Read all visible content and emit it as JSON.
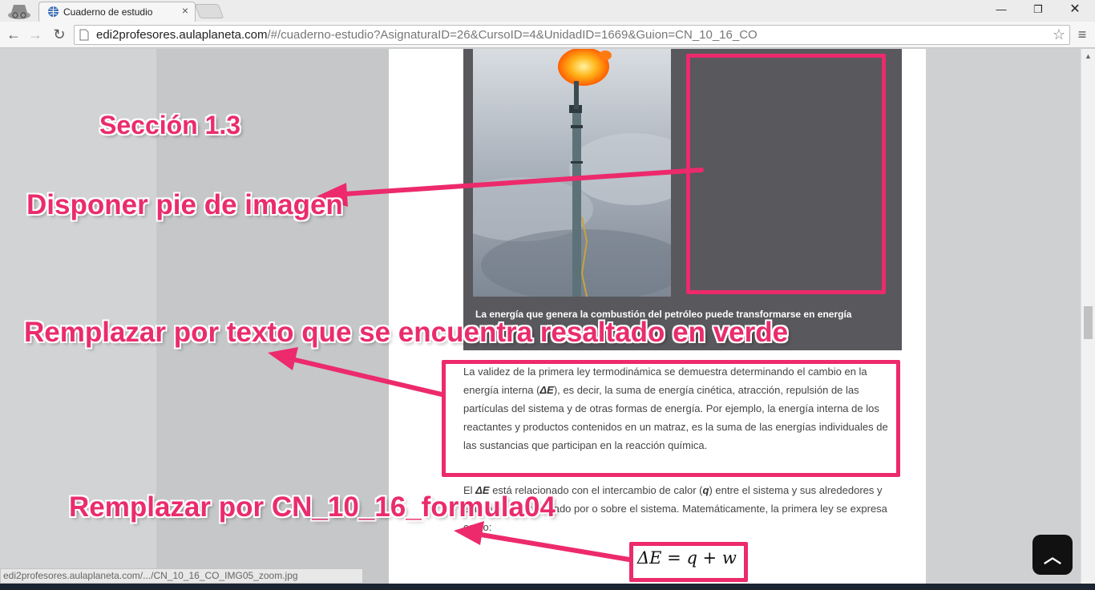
{
  "browser": {
    "tab_title": "Cuaderno de estudio",
    "tab_close": "×",
    "url_host": "edi2profesores.aulaplaneta.com",
    "url_path": "/#/cuaderno-estudio?AsignaturaID=26&CursoID=4&UnidadID=1669&Guion=CN_10_16_CO",
    "window_controls": {
      "minimize": "—",
      "maximize": "❐",
      "close": "✕"
    },
    "nav": {
      "back": "←",
      "forward": "→",
      "reload": "↻",
      "star": "☆",
      "menu": "≡"
    },
    "icons": [
      "incognito-icon",
      "globe-icon",
      "page-icon",
      "star-icon",
      "menu-icon"
    ]
  },
  "page": {
    "figure_caption": "La energía que genera la combustión del petróleo puede transformarse en energía",
    "paragraph1": {
      "before": "La validez de la primera ley termodinámica se demuestra determinando el cambio en la energía interna (",
      "symbol": "ΔE",
      "after": "), es decir, la suma de energía cinética, atracción, repulsión de las partículas del sistema y de otras formas de energía. Por ejemplo, la energía interna de los reactantes y productos contenidos en un matraz, es la suma de las energías individuales de las sustancias que participan en la reacción química."
    },
    "paragraph2": {
      "t1": "El ",
      "s1": "ΔE",
      "t2": " está relacionado con el intercambio de calor (",
      "s2": "q",
      "t3": ") entre el sistema y sus alrededores y el trabajo (",
      "s3": "W",
      "t4": ") realizado por o sobre el sistema. Matemáticamente, la primera ley se expresa como:"
    },
    "formula": "ΔE = q + w"
  },
  "annotations": {
    "seccion": "Sección 1.3",
    "pie_imagen": "Disponer pie de imagen",
    "remplazar_texto": "Remplazar por texto que se encuentra resaltado en verde",
    "remplazar_formula": "Remplazar por CN_10_16_formula04",
    "accent_color": "#ea2c6c"
  },
  "status": {
    "link_preview": "edi2profesores.aulaplaneta.com/.../CN_10_16_CO_IMG05_zoom.jpg",
    "scroll_top": "︿"
  }
}
